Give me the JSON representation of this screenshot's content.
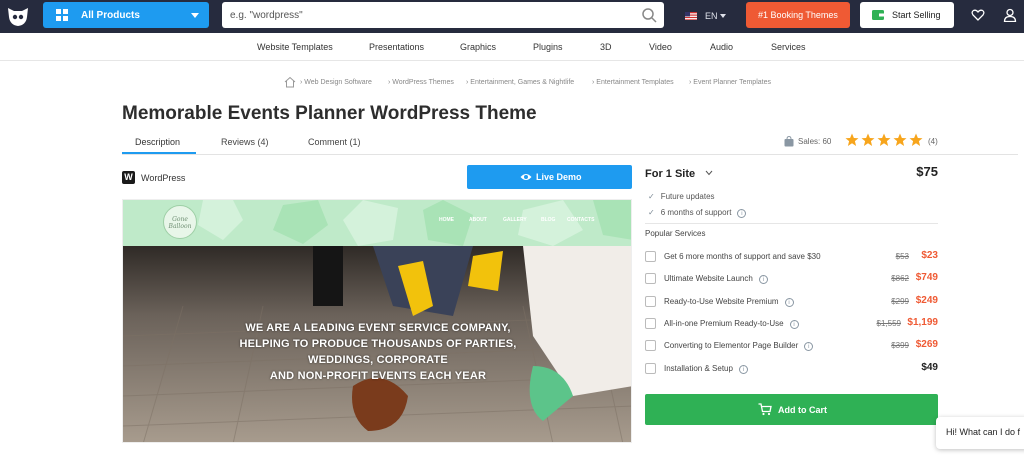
{
  "header": {
    "all_products_label": "All Products",
    "search_placeholder": "e.g. \"wordpress\"",
    "language": "EN",
    "booking_label": "#1 Booking Themes",
    "start_selling_label": "Start Selling"
  },
  "category_nav": [
    "Website Templates",
    "Presentations",
    "Graphics",
    "Plugins",
    "3D",
    "Video",
    "Audio",
    "Services"
  ],
  "breadcrumbs": [
    "Web Design Software",
    "WordPress Themes",
    "Entertainment, Games & Nightlife",
    "Entertainment Templates",
    "Event Planner Templates"
  ],
  "product": {
    "title": "Memorable Events Planner WordPress Theme",
    "platform": "WordPress",
    "live_demo_label": "Live Demo",
    "sales_label": "Sales: 60",
    "rating": 5,
    "review_count": "(4)"
  },
  "tabs": [
    {
      "label": "Description",
      "active": true
    },
    {
      "label": "Reviews (4)",
      "active": false
    },
    {
      "label": "Comment (1)",
      "active": false
    }
  ],
  "preview": {
    "logo_text": "Gone Balloon",
    "nav": [
      "HOME",
      "ABOUT",
      "GALLERY",
      "BLOG",
      "CONTACTS"
    ],
    "headline": [
      "WE ARE A LEADING EVENT SERVICE COMPANY,",
      "HELPING TO PRODUCE THOUSANDS OF PARTIES,",
      "WEDDINGS, CORPORATE",
      "AND NON-PROFIT EVENTS EACH YEAR"
    ]
  },
  "license": {
    "label": "For 1 Site",
    "price": "$75",
    "features": [
      "Future updates",
      "6 months of support"
    ]
  },
  "popular_services": {
    "title": "Popular Services",
    "items": [
      {
        "label": "Get 6 more months of support and save $30",
        "old_price": "$53",
        "price": "$23",
        "info": false
      },
      {
        "label": "Ultimate Website Launch",
        "old_price": "$862",
        "price": "$749",
        "info": true
      },
      {
        "label": "Ready-to-Use Website Premium",
        "old_price": "$299",
        "price": "$249",
        "info": true
      },
      {
        "label": "All-in-one Premium Ready-to-Use",
        "old_price": "$1,559",
        "price": "$1,199",
        "info": true
      },
      {
        "label": "Converting to Elementor Page Builder",
        "old_price": "$399",
        "price": "$269",
        "info": true
      },
      {
        "label": "Installation & Setup",
        "old_price": "",
        "price": "$49",
        "info": true
      }
    ]
  },
  "add_to_cart_label": "Add to Cart",
  "chat_text": "Hi! What can I do f",
  "colors": {
    "topbar": "#262b3e",
    "accent_blue": "#1e9bf0",
    "accent_orange": "#ef5a34",
    "cart_green": "#2fb155",
    "star": "#f7a51c"
  }
}
